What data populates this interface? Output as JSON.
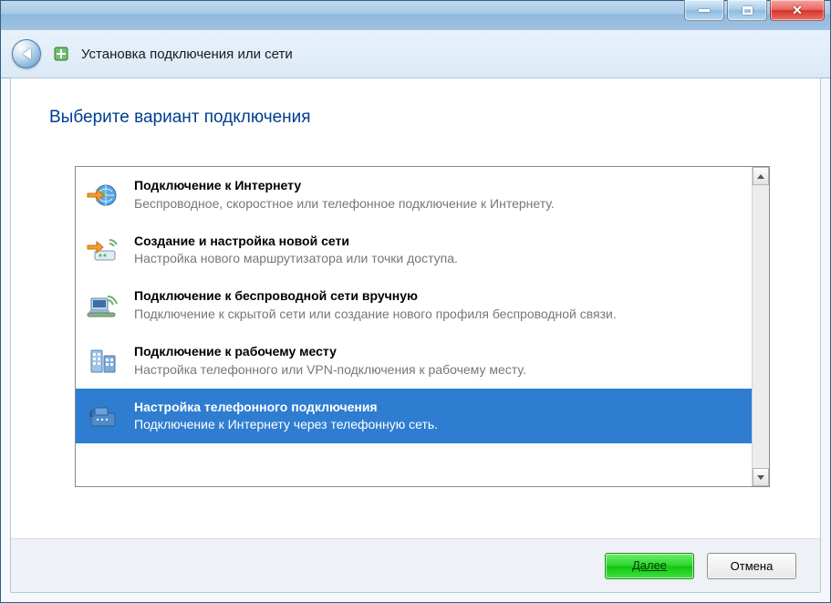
{
  "window": {
    "caption": ""
  },
  "header": {
    "wizard_title": "Установка подключения или сети"
  },
  "page": {
    "heading": "Выберите вариант подключения"
  },
  "options": [
    {
      "icon": "globe-arrow-icon",
      "title": "Подключение к Интернету",
      "desc": "Беспроводное, скоростное или телефонное подключение к Интернету.",
      "selected": false
    },
    {
      "icon": "router-new-icon",
      "title": "Создание и настройка новой сети",
      "desc": "Настройка нового маршрутизатора или точки доступа.",
      "selected": false
    },
    {
      "icon": "wifi-manual-icon",
      "title": "Подключение к беспроводной сети вручную",
      "desc": "Подключение к скрытой сети или создание нового профиля беспроводной связи.",
      "selected": false
    },
    {
      "icon": "workplace-icon",
      "title": "Подключение к рабочему месту",
      "desc": "Настройка телефонного или VPN-подключения к рабочему месту.",
      "selected": false
    },
    {
      "icon": "dialup-icon",
      "title": "Настройка телефонного подключения",
      "desc": "Подключение к Интернету через телефонную сеть.",
      "selected": true
    }
  ],
  "footer": {
    "next_label": "Далее",
    "cancel_label": "Отмена"
  },
  "colors": {
    "selection_bg": "#2f7dd1",
    "heading": "#003e8f"
  }
}
